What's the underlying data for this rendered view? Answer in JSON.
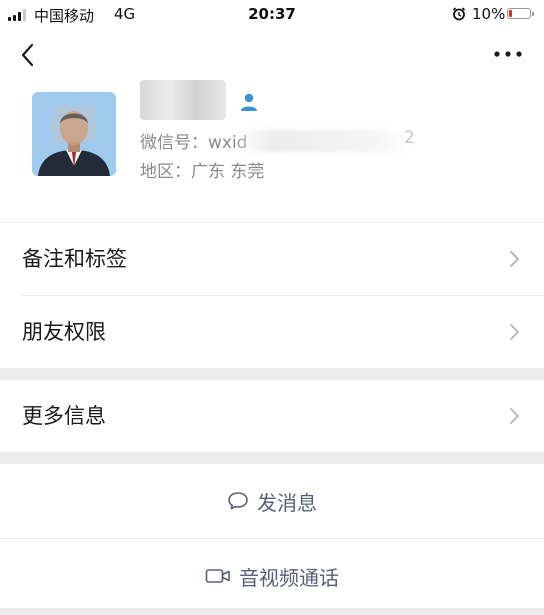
{
  "status_bar": {
    "carrier": "中国移动",
    "network": "4G",
    "time": "20:37",
    "battery_percent": "10%",
    "battery_level": 0.1,
    "icons": [
      "signal-icon",
      "alarm-icon",
      "battery-icon"
    ]
  },
  "nav": {
    "back_icon": "chevron-left-icon",
    "more_icon": "more-icon"
  },
  "profile": {
    "wechat_id_label": "微信号：wxid",
    "wechat_id_tail": "2",
    "region_label": "地区：广东 东莞",
    "contact_icon": "contact-person-icon",
    "accent_color": "#3d8fd8"
  },
  "menu": {
    "remarks_tags": "备注和标签",
    "friend_permissions": "朋友权限",
    "more_info": "更多信息"
  },
  "actions": {
    "send_message": "发消息",
    "video_call": "音视频通话",
    "link_color": "#56607a"
  }
}
